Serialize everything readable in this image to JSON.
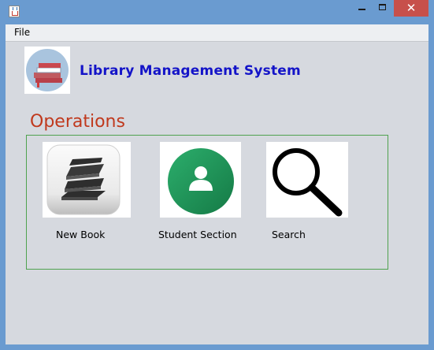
{
  "window": {
    "close_glyph": "✕"
  },
  "menubar": {
    "file_label": "File"
  },
  "header": {
    "title": "Library Management System"
  },
  "operations": {
    "heading": "Operations",
    "items": [
      {
        "label": "New Book",
        "icon": "books-icon"
      },
      {
        "label": "Student Section",
        "icon": "student-icon"
      },
      {
        "label": "Search",
        "icon": "magnifier-icon"
      }
    ]
  },
  "colors": {
    "titlebar": "#6a9bd0",
    "close_button": "#c7504b",
    "title_text": "#1414c8",
    "heading_text": "#c0391d",
    "panel_border": "#4fa24f",
    "student_icon_green": "#1f9e5e"
  }
}
